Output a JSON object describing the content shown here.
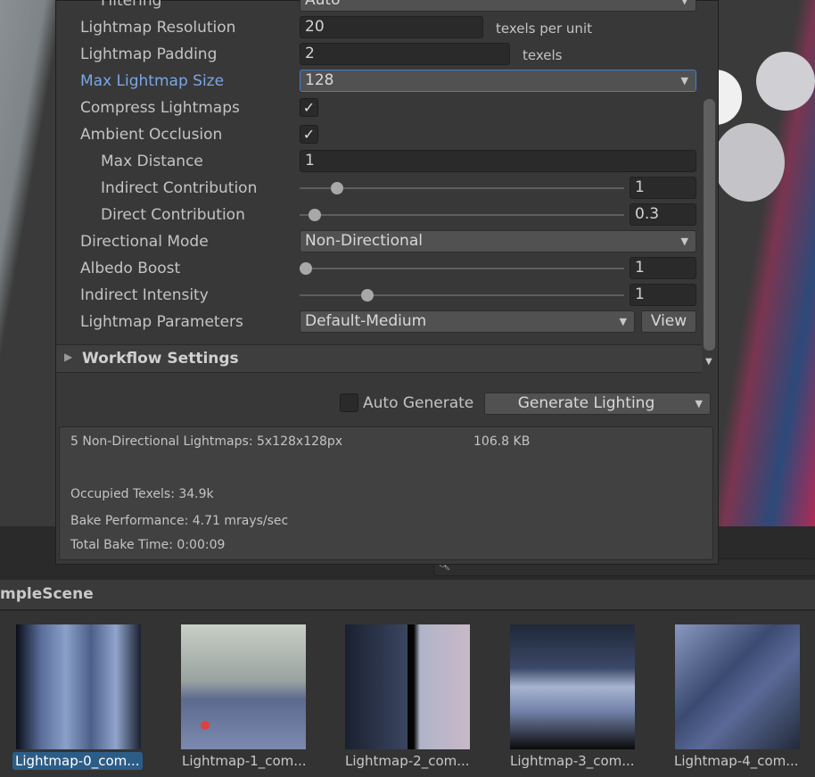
{
  "settings": {
    "filtering": {
      "label": "Filtering",
      "value": "Auto"
    },
    "lightmap_resolution": {
      "label": "Lightmap Resolution",
      "value": "20",
      "unit": "texels per unit"
    },
    "lightmap_padding": {
      "label": "Lightmap Padding",
      "value": "2",
      "unit": "texels"
    },
    "max_lightmap_size": {
      "label": "Max Lightmap Size",
      "value": "128"
    },
    "compress_lightmaps": {
      "label": "Compress Lightmaps",
      "checked": true,
      "glyph": "✓"
    },
    "ambient_occlusion": {
      "label": "Ambient Occlusion",
      "checked": true,
      "glyph": "✓"
    },
    "max_distance": {
      "label": "Max Distance",
      "value": "1"
    },
    "indirect_contribution": {
      "label": "Indirect Contribution",
      "value": "1",
      "slider_fraction": 0.1
    },
    "direct_contribution": {
      "label": "Direct Contribution",
      "value": "0.3",
      "slider_fraction": 0.03
    },
    "directional_mode": {
      "label": "Directional Mode",
      "value": "Non-Directional"
    },
    "albedo_boost": {
      "label": "Albedo Boost",
      "value": "1",
      "slider_fraction": 0
    },
    "indirect_intensity": {
      "label": "Indirect Intensity",
      "value": "1",
      "slider_fraction": 0.2
    },
    "lightmap_parameters": {
      "label": "Lightmap Parameters",
      "value": "Default-Medium",
      "view_label": "View"
    }
  },
  "workflow_settings": {
    "label": "Workflow Settings",
    "collapsed": true
  },
  "bake": {
    "auto_generate_label": "Auto Generate",
    "auto_generate_checked": false,
    "generate_label": "Generate Lighting"
  },
  "stats": {
    "lightmaps": "5 Non-Directional Lightmaps: 5x128x128px",
    "size": "106.8 KB",
    "occupied": "Occupied Texels: 34.9k",
    "performance": "Bake Performance: 4.71 mrays/sec",
    "time": "Total Bake Time: 0:00:09"
  },
  "project": {
    "breadcrumb": "mpleScene",
    "assets": [
      {
        "name": "Lightmap-0_com...",
        "selected": true
      },
      {
        "name": "Lightmap-1_com..."
      },
      {
        "name": "Lightmap-2_com..."
      },
      {
        "name": "Lightmap-3_com..."
      },
      {
        "name": "Lightmap-4_com..."
      }
    ]
  },
  "colors": {
    "accent": "#4a8fe0",
    "selection": "#2c5d87",
    "panel": "#383838"
  }
}
